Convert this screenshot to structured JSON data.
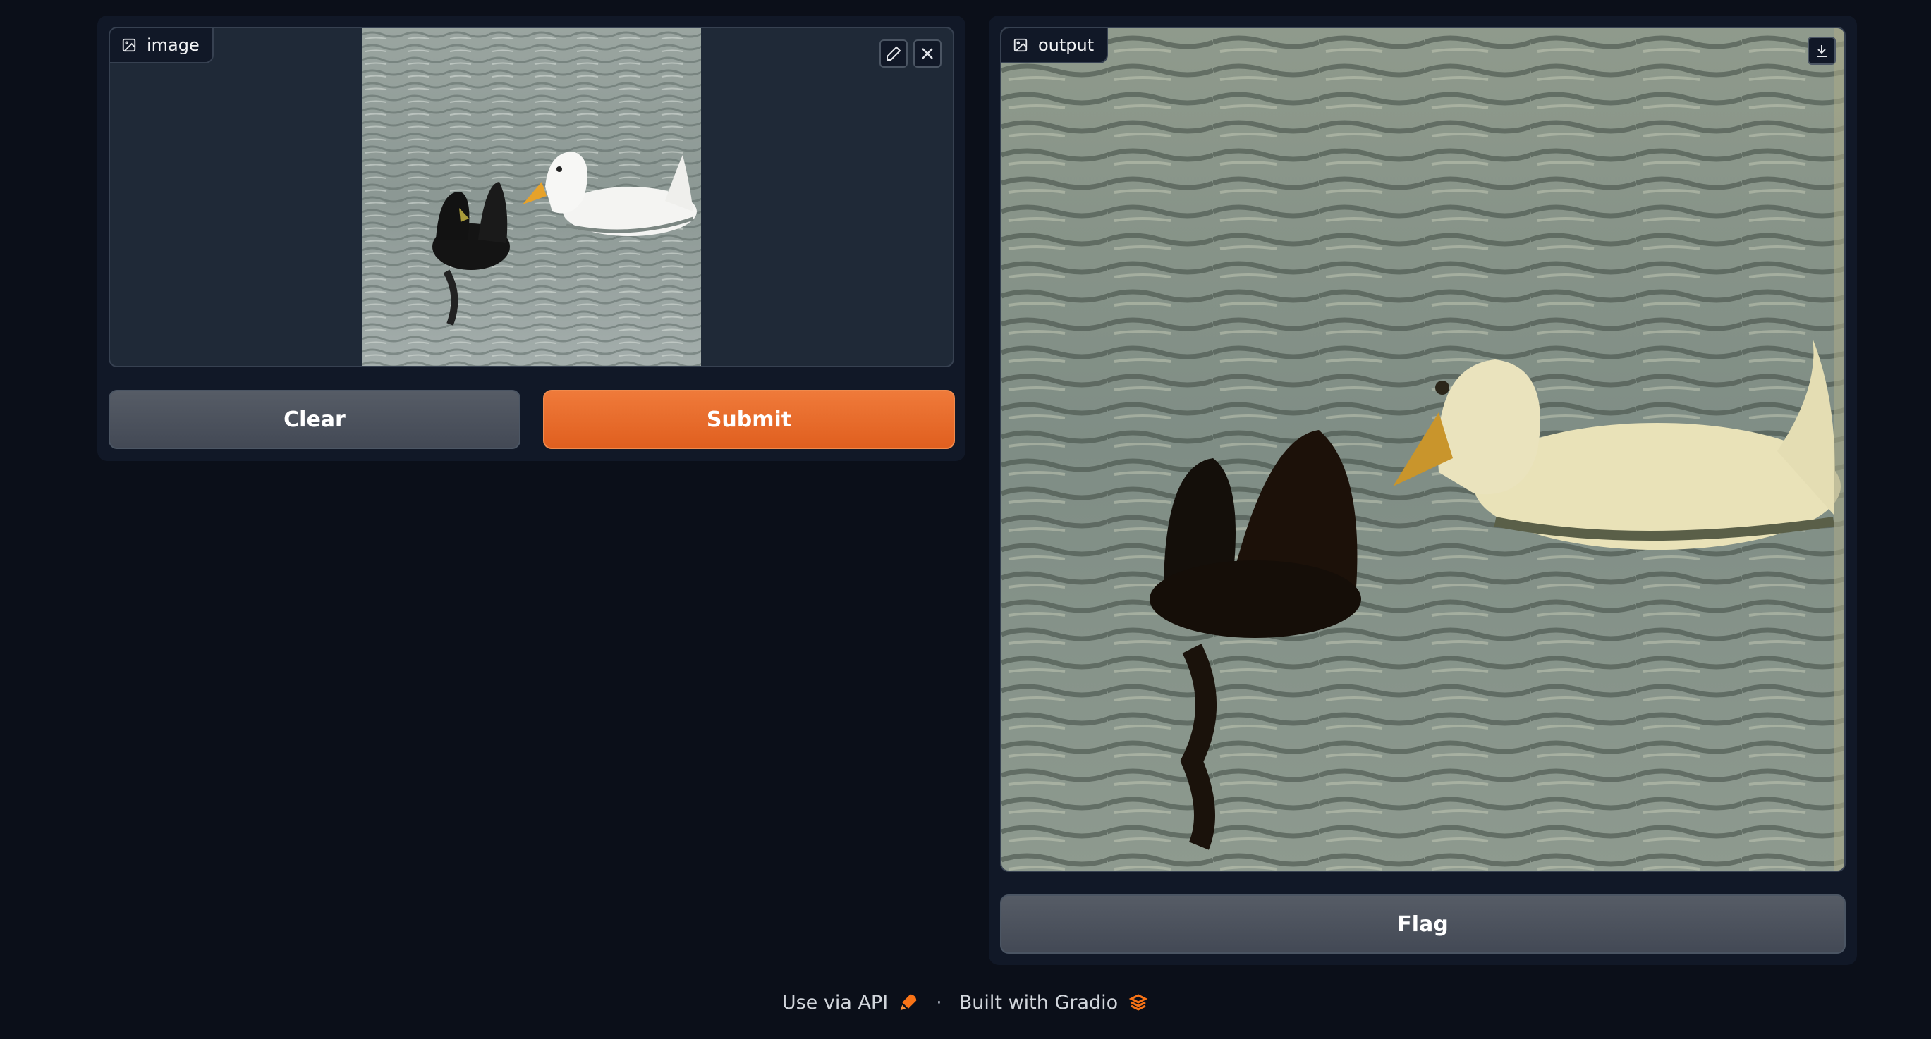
{
  "input": {
    "label": "image",
    "icons": [
      "image-icon",
      "edit-icon",
      "close-icon"
    ]
  },
  "output": {
    "label": "output",
    "icons": [
      "image-icon",
      "download-icon"
    ]
  },
  "buttons": {
    "clear": "Clear",
    "submit": "Submit",
    "flag": "Flag"
  },
  "footer": {
    "api": "Use via API",
    "separator": "·",
    "built": "Built with Gradio"
  },
  "colors": {
    "background": "#0b0f19",
    "panel": "#111827",
    "submit": "#e8692a",
    "secondary": "#4b5563"
  }
}
